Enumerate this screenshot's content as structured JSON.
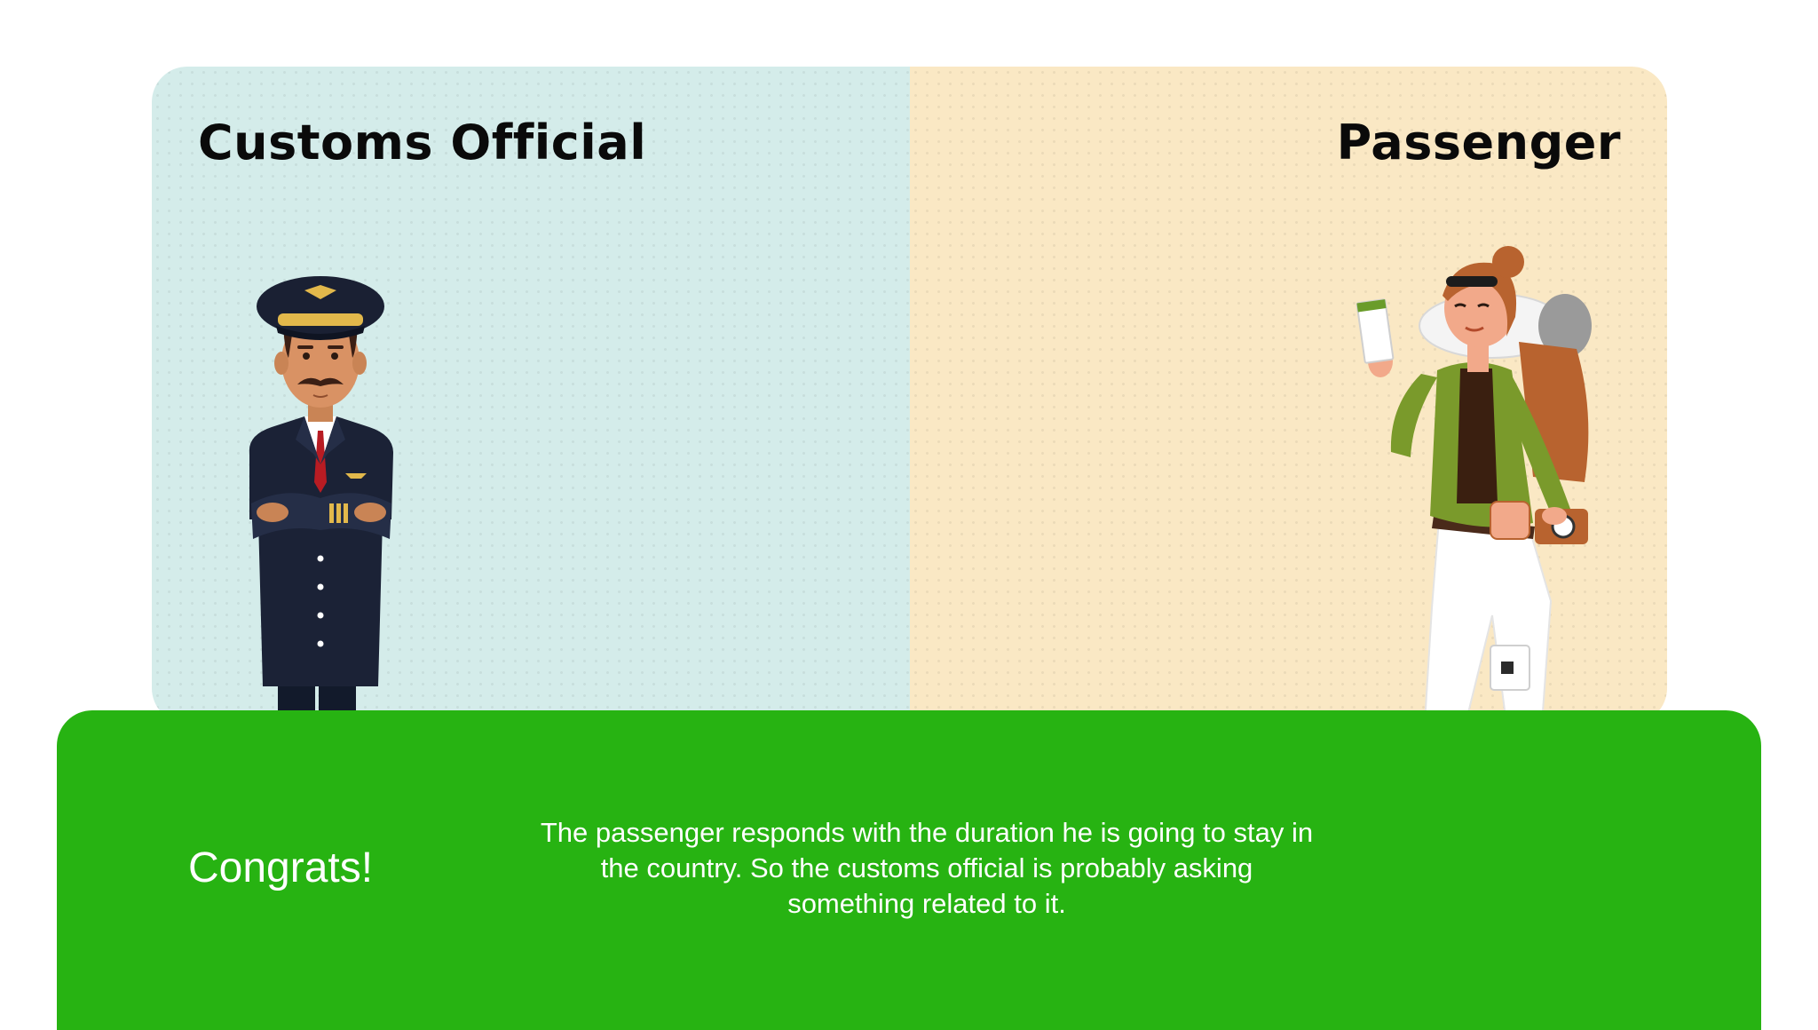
{
  "roles": {
    "left_title": "Customs Official",
    "right_title": "Passenger"
  },
  "feedback": {
    "heading": "Congrats!",
    "message": "The passenger responds with the duration he is going to stay in the country. So the customs official is probably asking something related to it."
  },
  "colors": {
    "left_panel": "#d4ecea",
    "right_panel": "#fae8c4",
    "feedback_bar": "#27b312"
  },
  "illustrations": {
    "left": "customs-officer-illustration",
    "right": "traveler-with-ticket-illustration"
  }
}
